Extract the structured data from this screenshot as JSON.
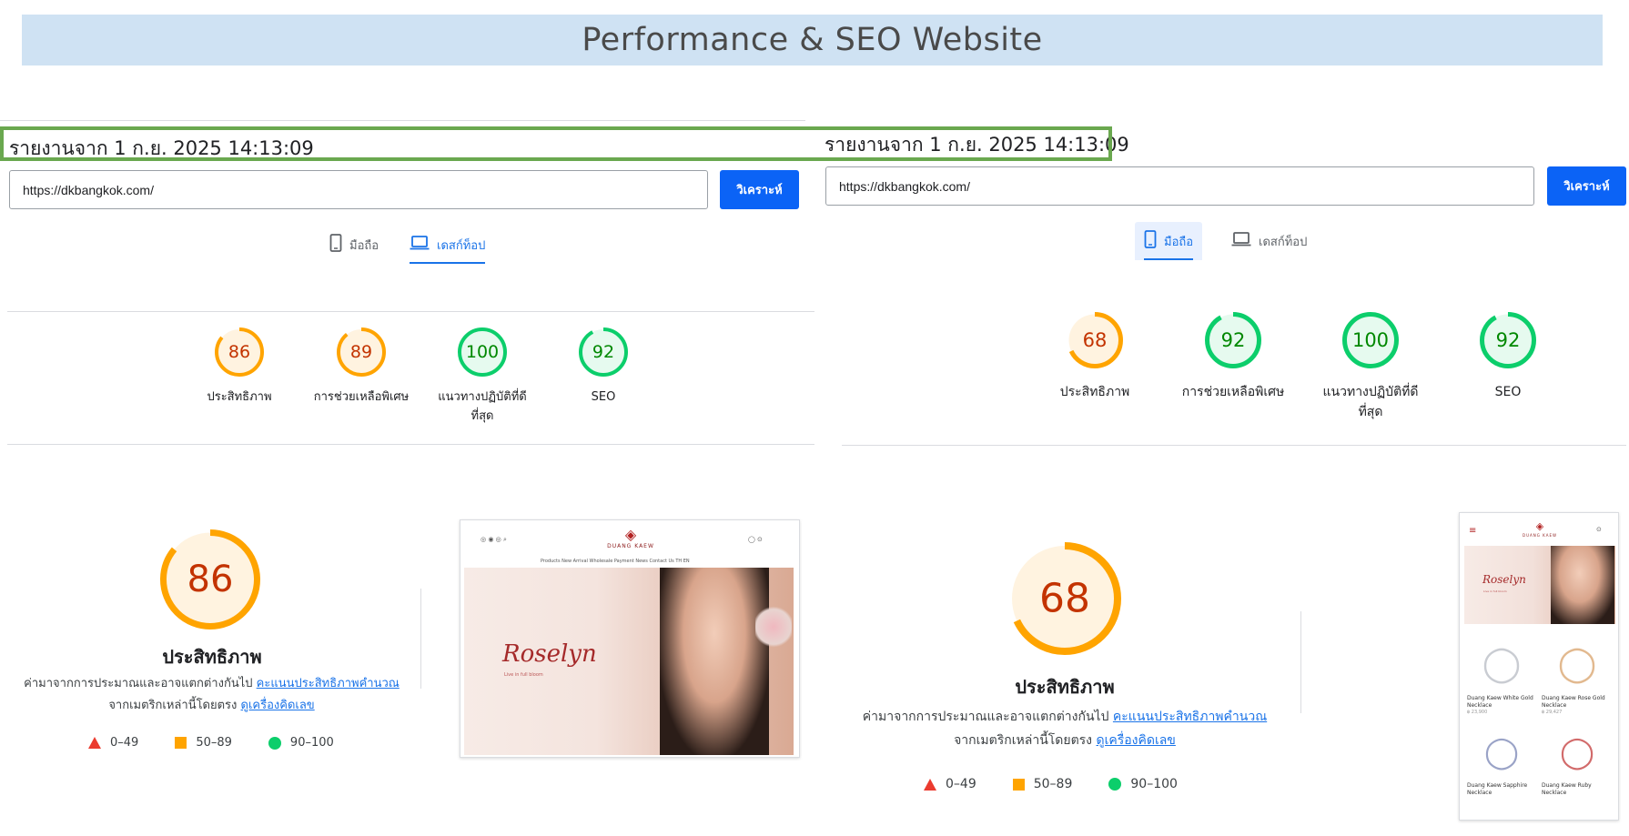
{
  "page_title": "Performance & SEO Website",
  "left": {
    "report_text": "รายงานจาก 1 ก.ย. 2025 14:13:09",
    "url_value": "https://dkbangkok.com/",
    "analyze_label": "วิเคราะห์",
    "tabs": [
      {
        "label": "มือถือ",
        "icon": "smartphone-icon",
        "active": false
      },
      {
        "label": "เดสก์ท็อป",
        "icon": "laptop-icon",
        "active": true
      }
    ],
    "scores": [
      {
        "value": 86,
        "label": "ประสิทธิภาพ",
        "color": "#ffa400"
      },
      {
        "value": 89,
        "label": "การช่วยเหลือพิเศษ",
        "color": "#ffa400"
      },
      {
        "value": 100,
        "label": "แนวทางปฏิบัติที่ดี",
        "label2": "ที่สุด",
        "color": "#0cce6b"
      },
      {
        "value": 92,
        "label": "SEO",
        "color": "#0cce6b"
      }
    ],
    "big_score": 86,
    "big_title": "ประสิทธิภาพ",
    "desc_line1_prefix": "ค่ามาจากการประมาณและอาจแตกต่างกันไป",
    "desc_link1": "คะแนนประสิทธิภาพคำนวณ",
    "desc_line2_prefix": "จากเมตริกเหล่านี้โดยตรง",
    "desc_link2": "ดูเครื่องคิดเลข"
  },
  "right": {
    "report_text": "รายงานจาก 1 ก.ย. 2025 14:13:09",
    "url_value": "https://dkbangkok.com/",
    "analyze_label": "วิเคราะห์",
    "tabs": [
      {
        "label": "มือถือ",
        "icon": "smartphone-icon",
        "active": true
      },
      {
        "label": "เดสก์ท็อป",
        "icon": "laptop-icon",
        "active": false
      }
    ],
    "scores": [
      {
        "value": 68,
        "label": "ประสิทธิภาพ",
        "color": "#ffa400"
      },
      {
        "value": 92,
        "label": "การช่วยเหลือพิเศษ",
        "color": "#0cce6b"
      },
      {
        "value": 100,
        "label": "แนวทางปฏิบัติที่ดี",
        "label2": "ที่สุด",
        "color": "#0cce6b"
      },
      {
        "value": 92,
        "label": "SEO",
        "color": "#0cce6b"
      }
    ],
    "big_score": 68,
    "big_title": "ประสิทธิภาพ",
    "desc_line1_prefix": "ค่ามาจากการประมาณและอาจแตกต่างกันไป",
    "desc_link1": "คะแนนประสิทธิภาพคำนวณ",
    "desc_line2_prefix": "จากเมตริกเหล่านี้โดยตรง",
    "desc_link2": "ดูเครื่องคิดเลข"
  },
  "legend": {
    "fail": "0–49",
    "average": "50–89",
    "pass": "90–100"
  },
  "site_preview": {
    "brand": "DUANG KAEW",
    "hero_title": "Roselyn",
    "hero_sub": "Live in full bloom",
    "menu": [
      "Products",
      "New Arrival",
      "Wholesale",
      "Payment",
      "News",
      "Contact Us",
      "TH",
      "EN"
    ],
    "products": [
      {
        "name": "Duang Kaew White Gold Necklace",
        "price": "฿ 23,900"
      },
      {
        "name": "Duang Kaew Rose Gold Necklace",
        "price": "฿ 29,427"
      },
      {
        "name": "Duang Kaew Sapphire Necklace",
        "price": ""
      },
      {
        "name": "Duang Kaew Ruby Necklace",
        "price": ""
      }
    ]
  }
}
